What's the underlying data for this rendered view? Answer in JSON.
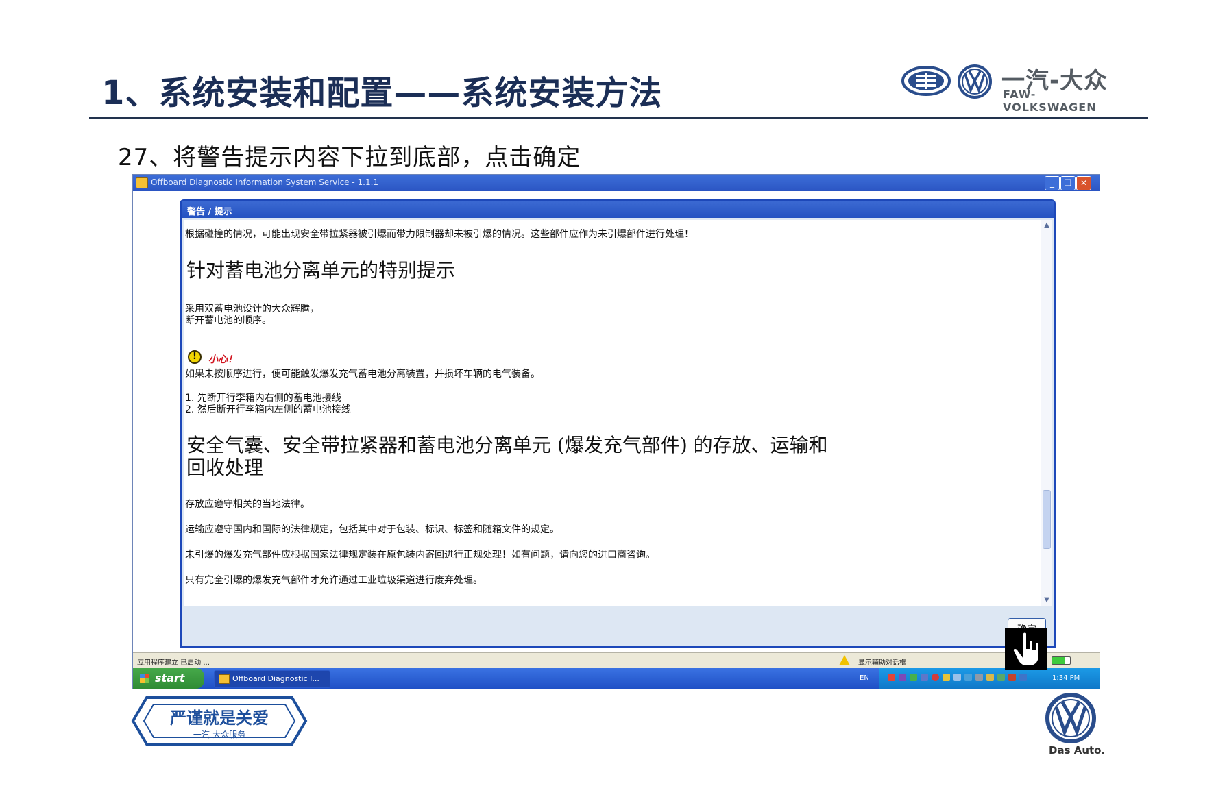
{
  "slide": {
    "title": "1、系统安装和配置——系统安装方法",
    "step": "27、将警告提示内容下拉到底部，点击确定"
  },
  "brand": {
    "name_cn": "一汽-大众",
    "name_en": "FAW-VOLKSWAGEN",
    "service_slogan": "严谨就是关爱",
    "service_sub": "一汽-大众服务",
    "das_auto": "Das Auto."
  },
  "window": {
    "title": "Offboard Diagnostic Information System Service - 1.1.1",
    "minimize": "_",
    "restore": "❐",
    "close": "✕"
  },
  "dialog": {
    "title": "警告 / 提示",
    "intro": "根据碰撞的情况，可能出现安全带拉紧器被引爆而带力限制器却未被引爆的情况。这些部件应作为未引爆部件进行处理！",
    "heading1": "针对蓄电池分离单元的特别提示",
    "para1_line1": "采用双蓄电池设计的大众辉腾，",
    "para1_line2": "断开蓄电池的顺序。",
    "caution_mark": "!",
    "caution": "小心！",
    "caution_text": "如果未按顺序进行，便可能触发爆发充气蓄电池分离装置，并损坏车辆的电气装备。",
    "step1": "1. 先断开行李箱内右侧的蓄电池接线",
    "step2": "2. 然后断开行李箱内左侧的蓄电池接线",
    "heading2_line1": "安全气囊、安全带拉紧器和蓄电池分离单元 (爆发充气部件) 的存放、运输和",
    "heading2_line2": "回收处理",
    "p_storage": "存放应遵守相关的当地法律。",
    "p_transport": "运输应遵守国内和国际的法律规定，包括其中对于包装、标识、标签和随箱文件的规定。",
    "p_unfired": "未引爆的爆发充气部件应根据国家法律规定装在原包装内寄回进行正规处理！如有问题，请向您的进口商咨询。",
    "p_fired": "只有完全引爆的爆发充气部件才允许通过工业垃圾渠道进行废弃处理。",
    "ok_label": "确定"
  },
  "scrollbar": {
    "position_fraction": 0.85
  },
  "status": {
    "left": "应用程序建立 已启动 ...",
    "right": "显示辅助对话框"
  },
  "taskbar": {
    "start": "start",
    "task": "Offboard Diagnostic I...",
    "lang": "EN",
    "clock": "1:34 PM"
  },
  "colors": {
    "title_blue": "#1b2e56",
    "xp_blue": "#2452c1",
    "start_green": "#2f8c34",
    "caution_red": "#d1131e"
  }
}
